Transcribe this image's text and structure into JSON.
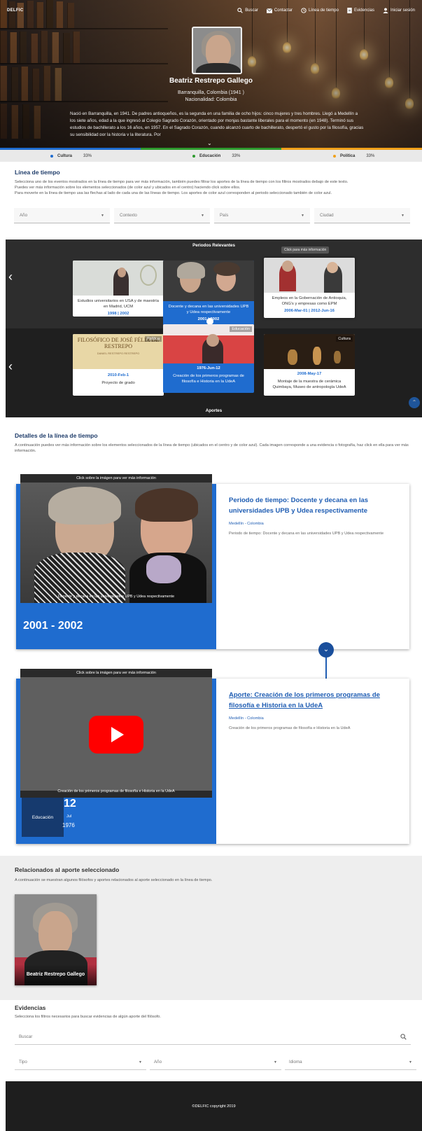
{
  "nav": {
    "logo": "DELFIC",
    "links": [
      {
        "label": "Buscar",
        "icon": "search-icon"
      },
      {
        "label": "Contactar",
        "icon": "mail-icon"
      },
      {
        "label": "Línea de tiempo",
        "icon": "history-icon"
      },
      {
        "label": "Evidencias",
        "icon": "document-icon"
      },
      {
        "label": "Iniciar sesión",
        "icon": "user-icon"
      }
    ]
  },
  "hero": {
    "name": "Beatriz Restrepo Gallego",
    "origin": "Barranquilla, Colombia (1941 )",
    "nationality": "Nacionalidad: Colombia",
    "bio": "Nació en Barranquilla, en 1941. De padres antioqueños, es la segunda en una familia de ocho hijos: cinco mujeres y tres hombres. Llegó a Medellín a los siete años, edad a la que ingresó al Colegio Sagrado Corazón, orientado por monjas bastante liberales para el momento (en 1948). Terminó sus estudios de bachillerato a los 16 años, en 1957. En el Sagrado Corazón, cuando alcanzó cuarto de bachillerato, despertó el gusto por la filosofía, gracias su sensibilidad por la historia y la literatura. Por"
  },
  "categories": [
    {
      "label": "Cultura",
      "percent": "33%",
      "color": "#1f6ccf"
    },
    {
      "label": "Educación",
      "percent": "33%",
      "color": "#2e9a2e"
    },
    {
      "label": "Política",
      "percent": "33%",
      "color": "#f0a019"
    }
  ],
  "timeline_intro": {
    "title": "Línea de tiempo",
    "text1": "Selecciona uno de los eventos mostrados en la línea de tiempo para ver más información, también puedes filtrar los aportes de la línea de tiempo con los filtros mostrados debajo de este texto.",
    "text2": "Puedes ver más información sobre los elementos seleccionados (de color azul y ubicados en el centro) haciendo click sobre ellos.",
    "text3": "Para moverte en la línea de tiempo usa las flechas al lado de cada una de las líneas de tiempo. Los aportes de color azul corresponden al periodo seleccionado también de color azul."
  },
  "filters": [
    {
      "placeholder": "Año"
    },
    {
      "placeholder": "Contexto"
    },
    {
      "placeholder": "País"
    },
    {
      "placeholder": "Ciudad"
    }
  ],
  "timeline": {
    "periods_label": "Periodos Relevantes",
    "contributions_label": "Aportes",
    "tooltip": "Click para más información",
    "periods": [
      {
        "text": "Estudios universitarios en USA y de maestría en Madrid, UCM",
        "date": "1998 | 2002"
      },
      {
        "text": "Docente y decana en las universidades UPB y Udea respectivamente",
        "date": "2001 | 2002"
      },
      {
        "text": "Empleos en la Gobernación de Antioquia, ONG's y empresas como EPM",
        "date": "2006-Mar-01 | 2012-Jun-16"
      }
    ],
    "contributions": [
      {
        "tag": "Política",
        "date": "2010-Feb-1",
        "text": "Proyecto de grado",
        "img_title": "FILOSÓFICO DE JOSÉ FÉLIX DE RESTREPO",
        "img_sub": "DANIEL RESTREPO RESTREPO"
      },
      {
        "tag": "Educación",
        "date": "1976-Jun-12",
        "text": "Creación de los primeros programas de filosofía e Historia en la UdeA"
      },
      {
        "tag": "Cultura",
        "date": "2008-May-17",
        "text": "Montaje de la muestra de cerámica Quimbaya, Museo de antropología UdeA"
      }
    ]
  },
  "details_intro": {
    "title": "Detalles de la línea de tiempo",
    "text": "A continuación puedes ver más información sobre los elementos seleccionados de la línea de tiempo (ubicados en el centro y de color azul). Cada imagen corresponde a una evidencia o fotografía, haz click en ella para ver más información."
  },
  "detail_period": {
    "hint": "Click sobre la imágen para ver más información",
    "caption": "Docente y decana en las universidades UPB y Udea respectivamente",
    "years": "2001 - 2002",
    "title": "Periodo de tiempo: Docente y decana en las universidades UPB y Udea respectivamente",
    "location": "Medellín - Colombia",
    "description": "Periodo de tiempo: Docente y decana en las universidades UPB y Udea respectivamente"
  },
  "detail_contribution": {
    "hint": "Click sobre la imágen para ver más información",
    "caption": "Creación de los primeros programas de filosofía e Historia en la UdeA",
    "category": "Educación",
    "day": "12",
    "month": "Jul",
    "year": "1976",
    "title": "Aporte: Creación de los primeros programas de filosofía e Historia en la UdeA",
    "location": "Medellín - Colombia",
    "description": "Creación de los primeros programas de filosofía e Historia en la UdeA"
  },
  "related": {
    "title": "Relacionados al aporte seleccionado",
    "text": "A continuación se muestran algunos filósofos y aportes relacionados al aporte seleccionado en la línea de tiempo.",
    "items": [
      {
        "name": "Beatriz Restrepo Gallego"
      }
    ]
  },
  "evidence": {
    "title": "Evidencias",
    "text": "Selecciona los filtros necesarios para buscar evidencias de algún aporte del filósofo.",
    "search_placeholder": "Buscar",
    "filters": [
      {
        "placeholder": "Tipo"
      },
      {
        "placeholder": "Año"
      },
      {
        "placeholder": "Idioma"
      }
    ]
  },
  "footer": {
    "text": "©DELFIC copyright 2019"
  }
}
